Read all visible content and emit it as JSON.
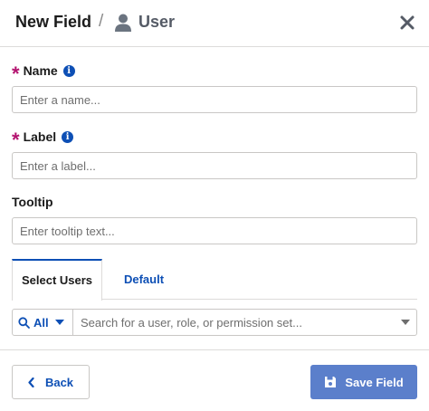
{
  "header": {
    "title": "New Field",
    "separator": "/",
    "object_label": "User",
    "object_icon": "user-icon",
    "close_icon": "close-icon"
  },
  "fields": {
    "name": {
      "label": "Name",
      "required": true,
      "placeholder": "Enter a name...",
      "value": ""
    },
    "label": {
      "label": "Label",
      "required": true,
      "placeholder": "Enter a label...",
      "value": ""
    },
    "tooltip": {
      "label": "Tooltip",
      "required": false,
      "placeholder": "Enter tooltip text...",
      "value": ""
    }
  },
  "tabs": [
    {
      "label": "Select Users",
      "active": true
    },
    {
      "label": "Default",
      "active": false
    }
  ],
  "search": {
    "scope": "All",
    "placeholder": "Search for a user, role, or permission set...",
    "value": ""
  },
  "footer": {
    "back_label": "Back",
    "save_label": "Save Field"
  },
  "colors": {
    "brand": "#0d4fb5",
    "required": "#b3136f",
    "save_button": "#5b7fcb"
  }
}
